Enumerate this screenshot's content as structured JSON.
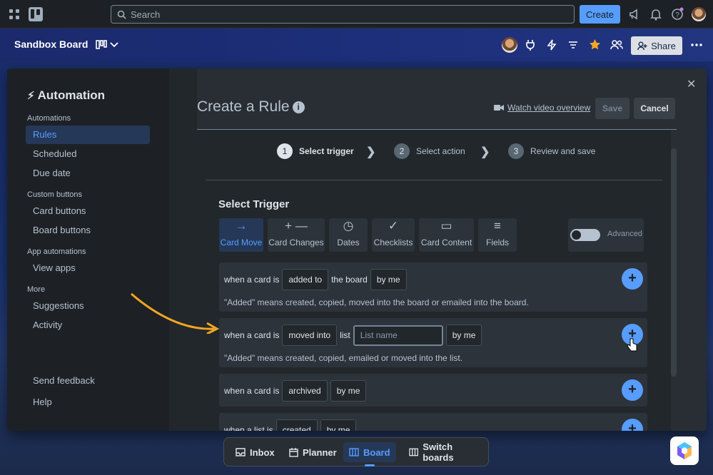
{
  "topbar": {
    "search_placeholder": "Search",
    "create_label": "Create"
  },
  "board": {
    "title": "Sandbox Board",
    "share_label": "Share"
  },
  "sidebar": {
    "title": "Automation",
    "sections": [
      {
        "label": "Automations",
        "items": [
          "Rules",
          "Scheduled",
          "Due date"
        ]
      },
      {
        "label": "Custom buttons",
        "items": [
          "Card buttons",
          "Board buttons"
        ]
      },
      {
        "label": "App automations",
        "items": [
          "View apps"
        ]
      },
      {
        "label": "More",
        "items": [
          "Suggestions",
          "Activity"
        ]
      }
    ],
    "active_item": "Rules",
    "feedback": "Send feedback",
    "help": "Help"
  },
  "rule": {
    "title": "Create a Rule",
    "watch_label": "Watch video overview",
    "save_label": "Save",
    "cancel_label": "Cancel",
    "steps": [
      {
        "num": "1",
        "label": "Select trigger"
      },
      {
        "num": "2",
        "label": "Select action"
      },
      {
        "num": "3",
        "label": "Review and save"
      }
    ],
    "select_trigger": "Select Trigger",
    "tabs": [
      "Card Move",
      "Card Changes",
      "Dates",
      "Checklists",
      "Card Content",
      "Fields"
    ],
    "advanced_label": "Advanced"
  },
  "triggers": [
    {
      "prefix": "when a card is",
      "action": "added to",
      "mid": "the board",
      "by": "by me",
      "note": "\"Added\" means created, copied, moved into the board or emailed into the board."
    },
    {
      "prefix": "when a card is",
      "action": "moved into",
      "mid": "list",
      "placeholder": "List name",
      "by": "by me",
      "note": "\"Added\" means created, copied, emailed or moved into the list."
    },
    {
      "prefix": "when a card is",
      "action": "archived",
      "by": "by me"
    },
    {
      "prefix": "when a list is",
      "action": "created",
      "by": "by me"
    }
  ],
  "bottom_nav": [
    "Inbox",
    "Planner",
    "Board",
    "Switch boards"
  ],
  "colors": {
    "accent": "#579dff",
    "modal_bg": "#282e33",
    "sidebar_bg": "#1d2125"
  }
}
